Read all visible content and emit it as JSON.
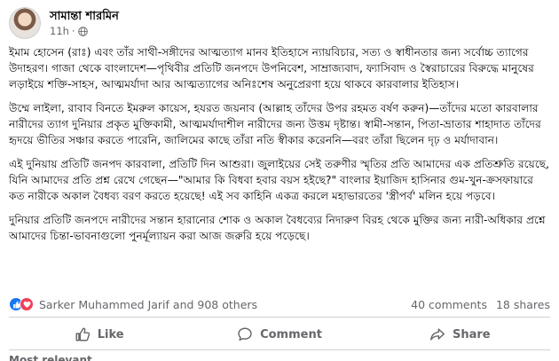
{
  "author": {
    "name": "সামান্তা শারমিন",
    "time": "11h",
    "dot": "·"
  },
  "post": {
    "paragraphs": [
      "ইমাম হোসেন (রাঃ) এবং তাঁর সাথী-সঙ্গীদের আত্মত্যাগ মানব ইতিহাসে ন্যায়বিচার, সত্য ও স্বাধীনতার জন্য সর্বোচ্চ ত্যাগের উদাহরণ। গাজা থেকে বাংলাদেশ—পৃথিবীর প্রতিটি জনপদে উপনিবেশ, সাম্রাজ্যবাদ, ফ্যাসিবাদ ও স্বৈরাচারের বিরুদ্ধে মানুষের লড়াইয়ে শক্তি-সাহস, আত্মমর্যাদা আর আত্মত্যাগের অনিঃশেষ অনুপ্রেরণা হয়ে থাকবে কারবালার ইতিহাস।",
      "উম্মে লাইলা, রাবাব বিনতে ইমরুল কায়েস, হযরত জয়নাব (আল্লাহ তাঁদের উপর রহমত বর্ষণ করুন)—তাঁদের মতো কারবালার নারীদের ত্যাগ দুনিয়ার প্রকৃত মুক্তিকামী, আত্মমর্যাদাশীল নারীদের জন্য উত্তম দৃষ্টান্ত। স্বামী-সন্তান, পিতা-ভ্রাতার শাহাদাত তাঁদের হৃদয়ে ভীতির সঞ্চার করতে পারেনি, জালিমের কাছে তাঁরা নতি স্বীকার করেননি—বরং তাঁরা ছিলেন দৃঢ় ও মর্যাদাবান।",
      "এই দুনিয়ায় প্রতিটি জনপদ কারবালা, প্রতিটি দিন আশুরা। জুলাইয়ের সেই তরুণীর স্মৃতির প্রতি আমাদের এক প্রতিশ্রুতি রয়েছে, যিনি আমাদের প্রতি প্রশ্ন রেখে গেছেন—\"আমার কি বিধবা হবার বয়স হইছে?\" বাংলার ইয়াজিদ হাসিনার গুম-খুন-ক্রসফায়ারে কত নারীকে অকাল বৈধব্য বরণ করতে হয়েছে! এই সব কাহিনি একত্র করলে মহাভারতের 'স্ত্রীপর্ব' মলিন হয়ে পড়বে।",
      "দুনিয়ার প্রতিটি জনপদে নারীদের সন্তান হারানোর শোক ও অকাল বৈধব্যের নিদারুণ বিরহ থেকে মুক্তির জন্য নারী-অধিকার প্রশ্নে আমাদের চিন্তা-ভাবনাগুলো পুনর্মূল্যায়ন করা আজ জরুরি হয়ে পড়েছে।"
    ]
  },
  "reactions": {
    "names": "Sarker Muhammed Jarif and 908 others",
    "comments": "40 comments",
    "shares": "18 shares",
    "icons": [
      "like-icon",
      "love-icon"
    ],
    "like_color": "#1877f2",
    "love_color": "#f33e58"
  },
  "actions": {
    "like": "Like",
    "comment": "Comment",
    "share": "Share"
  },
  "comments_filter": "Most relevant"
}
